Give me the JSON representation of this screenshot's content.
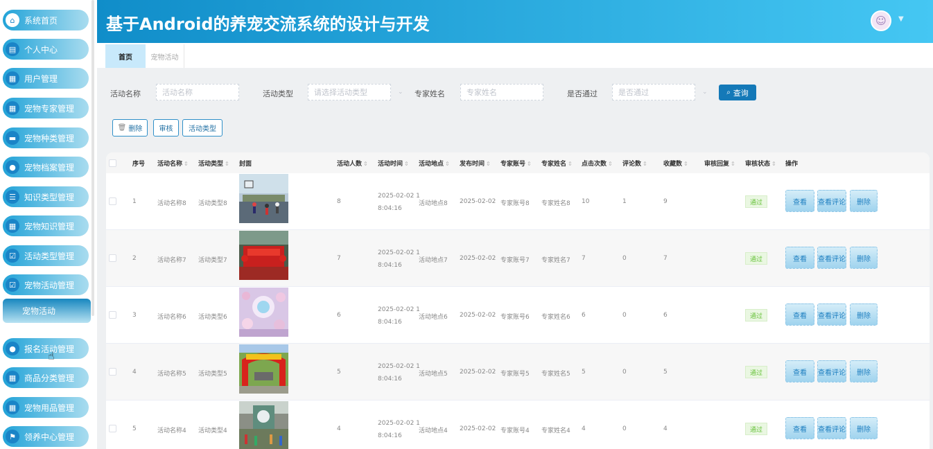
{
  "app_title": "基于Android的养宠交流系统的设计与开发",
  "sidebar": {
    "items": [
      {
        "label": "系统首页",
        "icon": "home-icon",
        "glyph": "⌂"
      },
      {
        "label": "个人中心",
        "icon": "profile-card-icon",
        "glyph": "▤"
      },
      {
        "label": "用户管理",
        "icon": "grid-icon",
        "glyph": "▦"
      },
      {
        "label": "宠物专家管理",
        "icon": "grid-icon",
        "glyph": "▦"
      },
      {
        "label": "宠物种类管理",
        "icon": "chat-icon",
        "glyph": "▬"
      },
      {
        "label": "宠物档案管理",
        "icon": "user-icon",
        "glyph": "●"
      },
      {
        "label": "知识类型管理",
        "icon": "list-icon",
        "glyph": "☰"
      },
      {
        "label": "宠物知识管理",
        "icon": "grid-icon",
        "glyph": "▦"
      },
      {
        "label": "活动类型管理",
        "icon": "checkbox-icon",
        "glyph": "☑"
      },
      {
        "label": "宠物活动管理",
        "icon": "checkbox-icon",
        "glyph": "☑"
      },
      {
        "label": "报名活动管理",
        "icon": "location-icon",
        "glyph": "●"
      },
      {
        "label": "商品分类管理",
        "icon": "grid-icon",
        "glyph": "▦"
      },
      {
        "label": "宠物用品管理",
        "icon": "grid-icon",
        "glyph": "▦"
      },
      {
        "label": "领养中心管理",
        "icon": "flag-icon",
        "glyph": "⚑"
      }
    ],
    "sub_item": "宠物活动"
  },
  "tabs": {
    "home": "首页",
    "active": "宠物活动"
  },
  "filters": {
    "name_label": "活动名称",
    "name_placeholder": "活动名称",
    "type_label": "活动类型",
    "type_placeholder": "请选择活动类型",
    "expert_label": "专家姓名",
    "expert_placeholder": "专家姓名",
    "pass_label": "是否通过",
    "pass_placeholder": "是否通过",
    "search_button": "查询"
  },
  "actions": {
    "delete": "删除",
    "review": "审核",
    "activity_type": "活动类型"
  },
  "table": {
    "headers": {
      "index": "序号",
      "name": "活动名称",
      "type": "活动类型",
      "cover": "封面",
      "count": "活动人数",
      "time": "活动时间",
      "place": "活动地点",
      "publish": "发布时间",
      "account": "专家账号",
      "expert": "专家姓名",
      "clicks": "点击次数",
      "comments": "评论数",
      "favs": "收藏数",
      "reply": "审核回复",
      "status": "审核状态",
      "ops": "操作"
    },
    "row_buttons": {
      "view": "查看",
      "view_comments": "查看评论",
      "delete": "删除"
    },
    "rows": [
      {
        "index": "1",
        "name": "活动名称8",
        "type": "活动类型8",
        "count": "8",
        "time_a": "2025-02-02 1",
        "time_b": "8:04:16",
        "place": "活动地点8",
        "publish": "2025-02-02",
        "account": "专家账号8",
        "expert": "专家姓名8",
        "clicks": "10",
        "comments": "1",
        "favs": "9",
        "status": "通过",
        "cover": "basketball-photo"
      },
      {
        "index": "2",
        "name": "活动名称7",
        "type": "活动类型7",
        "count": "7",
        "time_a": "2025-02-02 1",
        "time_b": "8:04:16",
        "place": "活动地点7",
        "publish": "2025-02-02",
        "account": "专家账号7",
        "expert": "专家姓名7",
        "clicks": "7",
        "comments": "0",
        "favs": "7",
        "status": "通过",
        "cover": "red-stage-photo"
      },
      {
        "index": "3",
        "name": "活动名称6",
        "type": "活动类型6",
        "count": "6",
        "time_a": "2025-02-02 1",
        "time_b": "8:04:16",
        "place": "活动地点6",
        "publish": "2025-02-02",
        "account": "专家账号6",
        "expert": "专家姓名6",
        "clicks": "6",
        "comments": "0",
        "favs": "6",
        "status": "通过",
        "cover": "balloon-party-photo"
      },
      {
        "index": "4",
        "name": "活动名称5",
        "type": "活动类型5",
        "count": "5",
        "time_a": "2025-02-02 1",
        "time_b": "8:04:16",
        "place": "活动地点5",
        "publish": "2025-02-02",
        "account": "专家账号5",
        "expert": "专家姓名5",
        "clicks": "5",
        "comments": "0",
        "favs": "5",
        "status": "通过",
        "cover": "festival-arch-photo"
      },
      {
        "index": "5",
        "name": "活动名称4",
        "type": "活动类型4",
        "count": "4",
        "time_a": "2025-02-02 1",
        "time_b": "8:04:16",
        "place": "活动地点4",
        "publish": "2025-02-02",
        "account": "专家账号4",
        "expert": "专家姓名4",
        "clicks": "4",
        "comments": "0",
        "favs": "4",
        "status": "通过",
        "cover": "mall-event-photo"
      }
    ]
  },
  "colors": {
    "header_start": "#108dc9",
    "header_end": "#45c7f3",
    "primary": "#1479b8",
    "status_green": "#67c23a"
  }
}
